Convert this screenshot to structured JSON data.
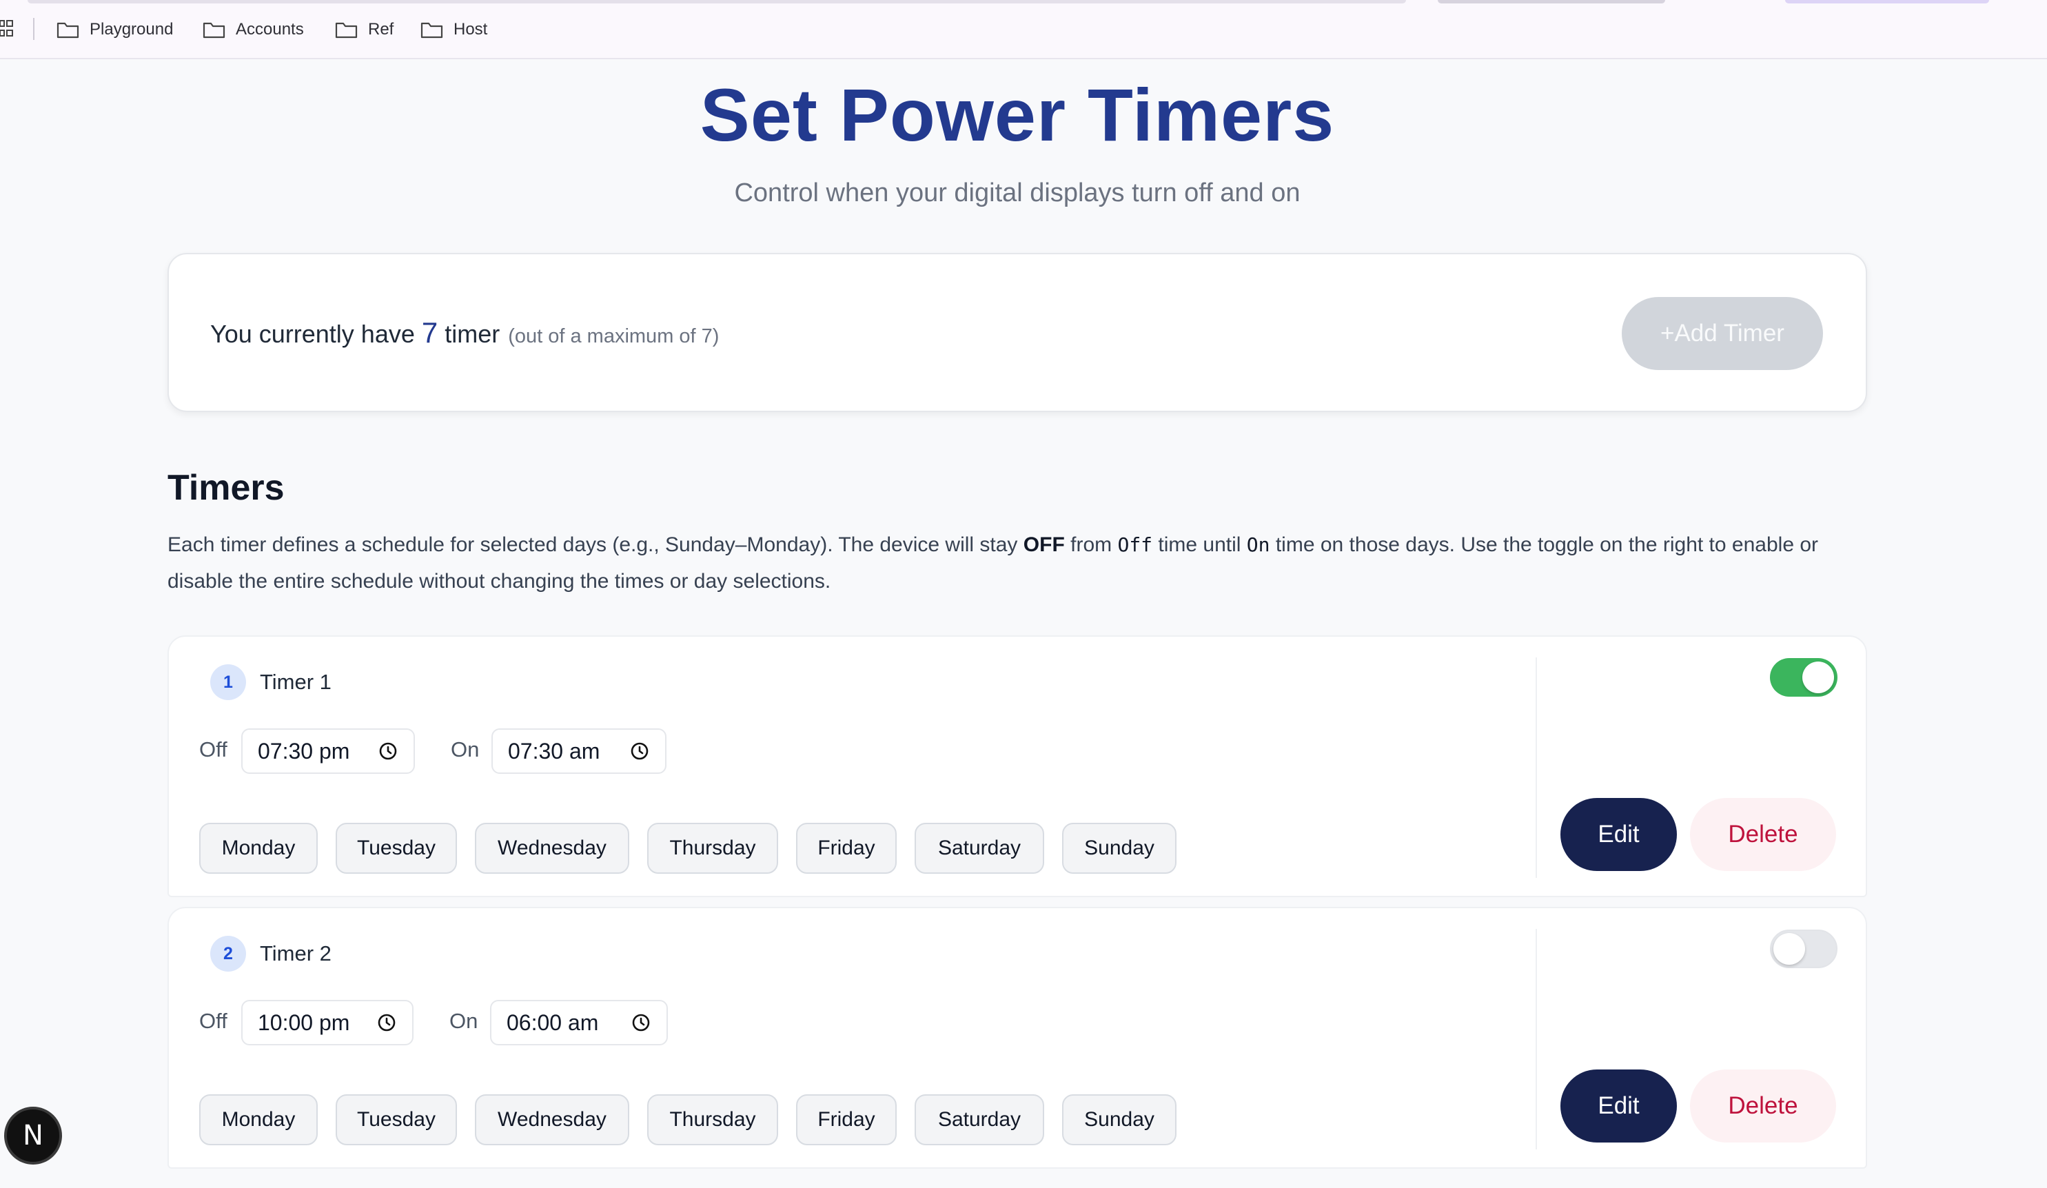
{
  "bookmarks": {
    "items": [
      {
        "label": "Playground"
      },
      {
        "label": "Accounts"
      },
      {
        "label": "Ref"
      },
      {
        "label": "Host"
      }
    ]
  },
  "header": {
    "title": "Set Power Timers",
    "subtitle": "Control when your digital displays turn off and on"
  },
  "summary": {
    "prefix": "You currently have",
    "count": "7",
    "suffix": "timer",
    "note": "(out of a maximum of 7)",
    "add_button": "+Add Timer"
  },
  "timers_section": {
    "title": "Timers",
    "desc_1": "Each timer defines a schedule for selected days (e.g., Sunday–Monday). The device will stay",
    "desc_off_bold": "OFF",
    "desc_2": "from",
    "desc_code_off": "Off",
    "desc_3": "time until",
    "desc_code_on": "On",
    "desc_4": "time on those days. Use the toggle on the right to enable or disable the entire schedule without changing the times or day selections."
  },
  "labels": {
    "off": "Off",
    "on": "On",
    "edit": "Edit",
    "delete": "Delete"
  },
  "timers": [
    {
      "number": "1",
      "name": "Timer 1",
      "off_time": "07:30 pm",
      "on_time": "07:30 am",
      "enabled": true,
      "days": [
        "Monday",
        "Tuesday",
        "Wednesday",
        "Thursday",
        "Friday",
        "Saturday",
        "Sunday"
      ]
    },
    {
      "number": "2",
      "name": "Timer 2",
      "off_time": "10:00 pm",
      "on_time": "06:00 am",
      "enabled": false,
      "days": [
        "Monday",
        "Tuesday",
        "Wednesday",
        "Thursday",
        "Friday",
        "Saturday",
        "Sunday"
      ]
    }
  ],
  "floating_badge": "N",
  "colors": {
    "title": "#233a8f",
    "toggle_on": "#3bb55d",
    "edit_button": "#17224f",
    "delete_text": "#be123c"
  }
}
